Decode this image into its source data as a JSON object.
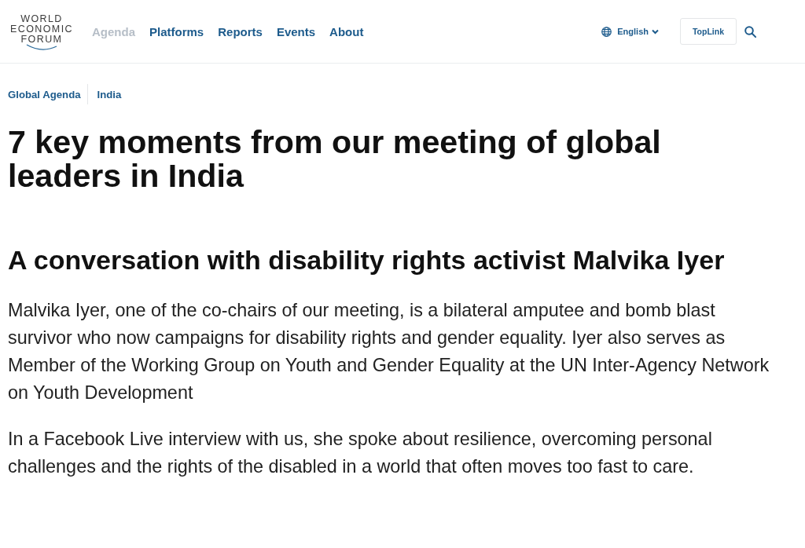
{
  "header": {
    "logo": {
      "lines": [
        "WORLD",
        "ECONOMIC",
        "FORUM"
      ]
    },
    "nav": [
      {
        "label": "Agenda",
        "selected": true
      },
      {
        "label": "Platforms",
        "selected": false
      },
      {
        "label": "Reports",
        "selected": false
      },
      {
        "label": "Events",
        "selected": false
      },
      {
        "label": "About",
        "selected": false
      }
    ],
    "language": {
      "label": "English"
    },
    "toplink_button": {
      "label": "TopLink"
    }
  },
  "breadcrumbs": [
    {
      "label": "Global Agenda"
    },
    {
      "label": "India"
    }
  ],
  "article": {
    "title": "7 key moments from our meeting of global leaders in India",
    "section_heading": "A conversation with disability rights activist Malvika Iyer",
    "paragraphs": [
      "Malvika Iyer, one of the co-chairs of our meeting, is a bilateral amputee and bomb blast survivor who now campaigns for disability rights and gender equality. Iyer also serves as Member of the Working Group on Youth and Gender Equality at the UN Inter-Agency Network on Youth Development",
      "In a Facebook Live interview with us, she spoke about resilience, overcoming personal challenges and the rights of the disabled in a world that often moves too fast to care."
    ]
  }
}
